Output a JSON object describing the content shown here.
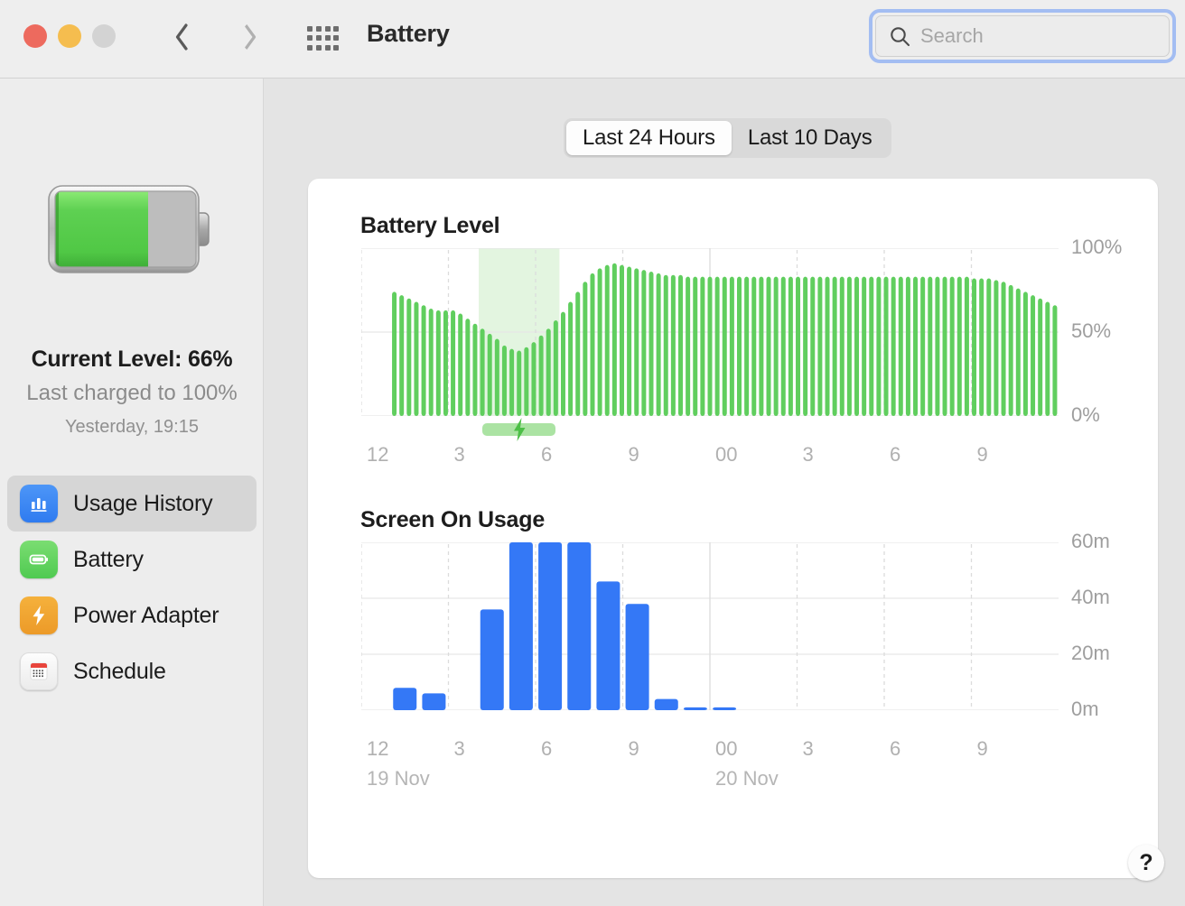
{
  "window": {
    "title": "Battery",
    "traffic_lights": [
      "close",
      "minimize",
      "zoom"
    ],
    "back_label": "Back",
    "forward_label": "Forward",
    "grid_label": "Show All"
  },
  "search": {
    "value": "",
    "placeholder": "Search"
  },
  "sidebar": {
    "current_level": "Current Level: 66%",
    "last_charged": "Last charged to 100%",
    "last_charged_when": "Yesterday, 19:15",
    "battery_percent": 66,
    "items": [
      {
        "label": "Usage History",
        "icon": "bar-chart-icon",
        "selected": true
      },
      {
        "label": "Battery",
        "icon": "battery-icon",
        "selected": false
      },
      {
        "label": "Power Adapter",
        "icon": "bolt-icon",
        "selected": false
      },
      {
        "label": "Schedule",
        "icon": "calendar-icon",
        "selected": false
      }
    ]
  },
  "segmented": {
    "options": [
      "Last 24 Hours",
      "Last 10 Days"
    ],
    "selected": "Last 24 Hours"
  },
  "help": {
    "label": "?"
  },
  "colors": {
    "battery_green": "#60ce5e",
    "charge_band": "#e3f5e0",
    "charge_bar": "#abe3a3",
    "screen_blue": "#3478f6",
    "sidebar_bg": "#ededed",
    "content_bg": "#e4e4e4",
    "panel_bg": "#ffffff",
    "selected_row": "#d6d6d6",
    "focus_ring": "#a3bdf2"
  },
  "chart_data": [
    {
      "type": "bar",
      "name": "battery-level-chart",
      "title": "Battery Level",
      "xlabel": "",
      "ylabel": "",
      "ylim": [
        0,
        100
      ],
      "yticks": [
        0,
        50,
        100
      ],
      "ytick_labels": [
        "0%",
        "50%",
        "100%"
      ],
      "xtick_labels": [
        "12",
        "3",
        "6",
        "9",
        "00",
        "3",
        "6",
        "9"
      ],
      "xtick_positions": [
        0,
        3,
        6,
        9,
        12,
        15,
        18,
        21
      ],
      "grid": true,
      "bar_color": "#60ce5e",
      "charge_band": {
        "start_index": 16,
        "end_index": 26,
        "label": "charging"
      },
      "x_start_hour": 12,
      "series": [
        {
          "name": "Battery Level (%)",
          "values": [
            null,
            null,
            null,
            null,
            74,
            72,
            70,
            68,
            66,
            64,
            63,
            63,
            63,
            61,
            58,
            55,
            52,
            49,
            46,
            42,
            40,
            39,
            41,
            44,
            48,
            52,
            57,
            62,
            68,
            74,
            80,
            85,
            88,
            90,
            91,
            90,
            89,
            88,
            87,
            86,
            85,
            84,
            84,
            84,
            83,
            83,
            83,
            83,
            83,
            83,
            83,
            83,
            83,
            83,
            83,
            83,
            83,
            83,
            83,
            83,
            83,
            83,
            83,
            83,
            83,
            83,
            83,
            83,
            83,
            83,
            83,
            83,
            83,
            83,
            83,
            83,
            83,
            83,
            83,
            83,
            83,
            83,
            83,
            82,
            82,
            82,
            81,
            80,
            78,
            76,
            74,
            72,
            70,
            68,
            66
          ]
        }
      ]
    },
    {
      "type": "bar",
      "name": "screen-on-usage-chart",
      "title": "Screen On Usage",
      "xlabel": "",
      "ylabel": "",
      "ylim": [
        0,
        60
      ],
      "yticks": [
        0,
        20,
        40,
        60
      ],
      "ytick_labels": [
        "0m",
        "20m",
        "40m",
        "60m"
      ],
      "xtick_labels": [
        "12",
        "3",
        "6",
        "9",
        "00",
        "3",
        "6",
        "9"
      ],
      "xtick_positions": [
        0,
        3,
        6,
        9,
        12,
        15,
        18,
        21
      ],
      "date_labels": [
        {
          "text": "19 Nov",
          "at_index": 0
        },
        {
          "text": "20 Nov",
          "at_index": 12
        }
      ],
      "grid": true,
      "bar_color": "#3478f6",
      "x_start_hour": 12,
      "series": [
        {
          "name": "Screen On Usage (minutes)",
          "values": [
            0,
            8,
            6,
            0,
            36,
            60,
            60,
            60,
            46,
            38,
            4,
            1,
            1,
            0,
            0,
            0,
            0,
            0,
            0,
            0,
            0,
            0,
            0,
            0
          ]
        }
      ]
    }
  ]
}
